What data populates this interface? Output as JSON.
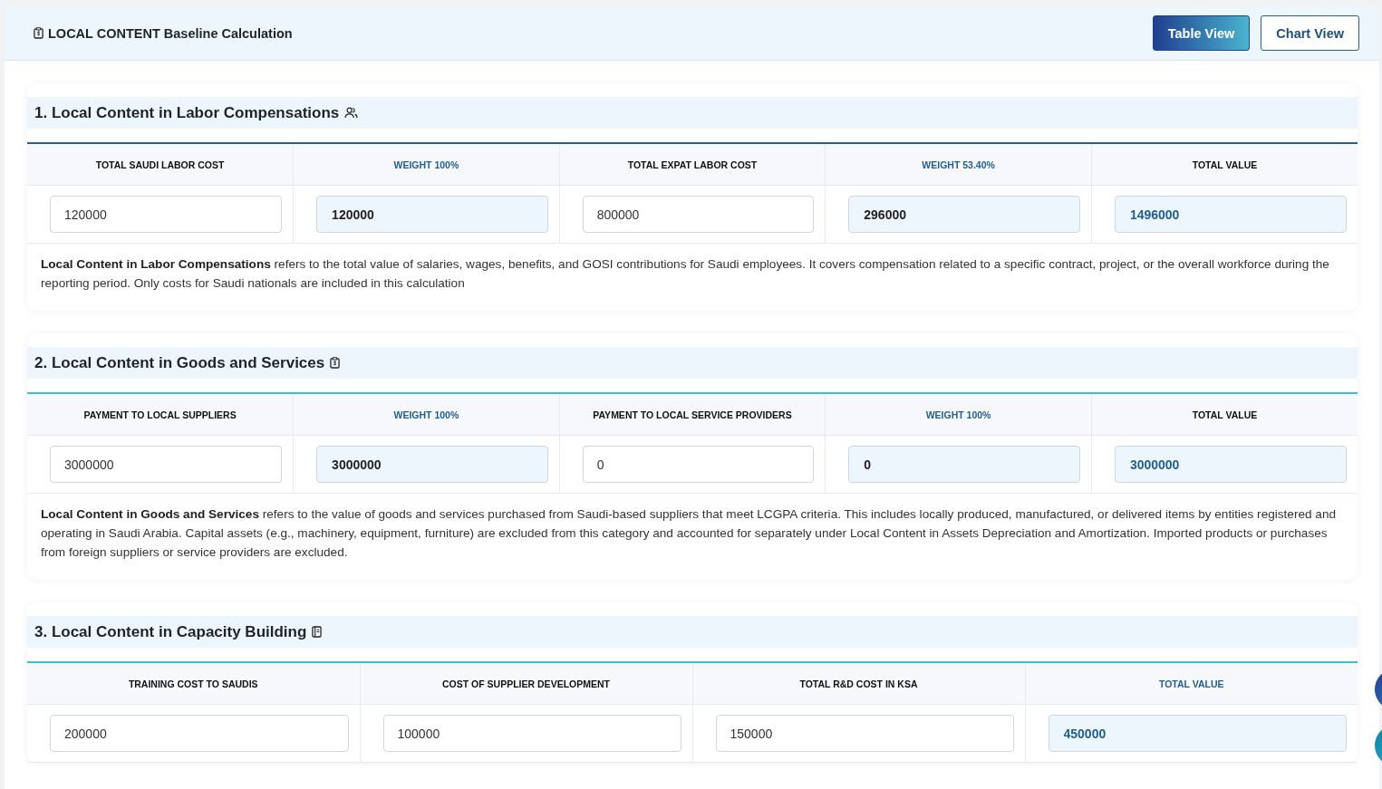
{
  "header": {
    "title": "LOCAL CONTENT Baseline Calculation"
  },
  "view_tabs": [
    {
      "label": "Table View",
      "selected": true
    },
    {
      "label": "Chart View",
      "selected": false
    }
  ],
  "sections": [
    {
      "title": "1. Local Content in Labor Compensations",
      "color": "#2a5f93",
      "columns": [
        {
          "header": "TOTAL SAUDI LABOR COST",
          "accent": false,
          "kind": "input",
          "value": "120000"
        },
        {
          "header": "WEIGHT 100%",
          "accent": true,
          "kind": "computed",
          "value": "120000"
        },
        {
          "header": "TOTAL EXPAT LABOR COST",
          "accent": false,
          "kind": "input",
          "value": "800000"
        },
        {
          "header": "WEIGHT 53.40%",
          "accent": true,
          "kind": "computed",
          "value": "296000"
        },
        {
          "header": "TOTAL VALUE",
          "accent": false,
          "kind": "total",
          "value": "1496000"
        }
      ],
      "description": "**Local Content in Labor Compensations** refers to the total value of salaries, wages, benefits, and GOSI contributions for Saudi employees. It covers compensation related to a specific contract, project, or the overall workforce during the reporting period. Only costs for Saudi nationals are included in this calculation"
    },
    {
      "title": "2. Local Content in Goods and Services",
      "color": "#3cc0d0",
      "columns": [
        {
          "header": "PAYMENT TO LOCAL SUPPLIERS",
          "accent": false,
          "kind": "input",
          "value": "3000000"
        },
        {
          "header": "WEIGHT 100%",
          "accent": true,
          "kind": "computed",
          "value": "3000000"
        },
        {
          "header": "PAYMENT TO LOCAL SERVICE PROVIDERS",
          "accent": false,
          "kind": "input",
          "value": "0"
        },
        {
          "header": "WEIGHT 100%",
          "accent": true,
          "kind": "computed",
          "value": "0"
        },
        {
          "header": "TOTAL VALUE",
          "accent": false,
          "kind": "total",
          "value": "3000000"
        }
      ],
      "description": "**Local Content in Goods and Services** refers to the value of goods and services purchased from Saudi-based suppliers that meet LCGPA criteria. This includes locally produced, manufactured, or delivered items by entities registered and operating in Saudi Arabia. Capital assets (e.g., machinery, equipment, furniture) are excluded from this category and accounted for separately under Local Content in Assets Depreciation and Amortization. Imported products or purchases from foreign suppliers or service providers are excluded."
    },
    {
      "title": "3. Local Content in Capacity Building",
      "color": "#3cc0d0",
      "columns": [
        {
          "header": "TRAINING COST TO SAUDIS",
          "accent": false,
          "kind": "input",
          "value": "200000"
        },
        {
          "header": "COST OF SUPPLIER DEVELOPMENT",
          "accent": false,
          "kind": "input",
          "value": "100000"
        },
        {
          "header": "TOTAL R&D COST IN KSA",
          "accent": false,
          "kind": "input",
          "value": "150000"
        },
        {
          "header": "TOTAL VALUE",
          "accent": true,
          "kind": "total",
          "value": "450000"
        }
      ]
    }
  ]
}
